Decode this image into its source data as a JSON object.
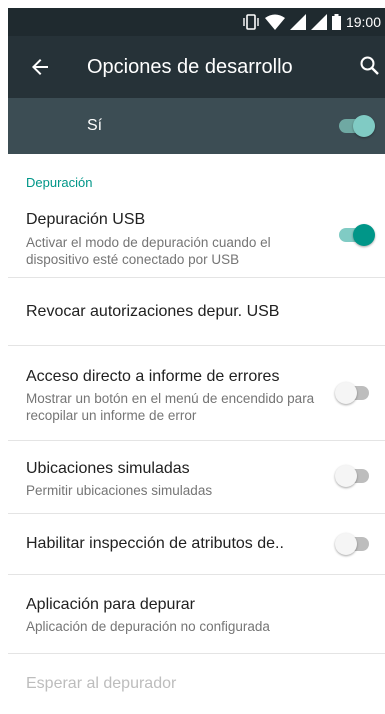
{
  "status_bar": {
    "time": "19:00",
    "icons": [
      "vibrate-icon",
      "wifi-icon",
      "signal-icon",
      "signal-icon",
      "battery-icon"
    ]
  },
  "app_bar": {
    "title": "Opciones de desarrollo",
    "back_icon": "arrow-left-icon",
    "search_icon": "search-icon"
  },
  "master_switch": {
    "label": "Sí",
    "checked": true
  },
  "colors": {
    "accent": "#009688",
    "app_bar": "#263238",
    "status_bar": "#1f2a2f",
    "master_bar": "#3c4d54"
  },
  "category": "Depuración",
  "items": [
    {
      "title": "Depuración USB",
      "summary": "Activar el modo de depuración cuando el dispositivo esté conectado por USB",
      "toggle": "on"
    },
    {
      "title": "Revocar autorizaciones depur. USB"
    },
    {
      "title": "Acceso directo a informe de errores",
      "summary": "Mostrar un botón en el menú de encendido para recopilar un informe de error",
      "toggle": "off"
    },
    {
      "title": "Ubicaciones simuladas",
      "summary": "Permitir ubicaciones simuladas",
      "toggle": "off"
    },
    {
      "title": "Habilitar inspección de atributos de..",
      "toggle": "off"
    },
    {
      "title": "Aplicación para depurar",
      "summary": "Aplicación de depuración no configurada"
    },
    {
      "title": "Esperar al depurador",
      "disabled": true
    }
  ]
}
